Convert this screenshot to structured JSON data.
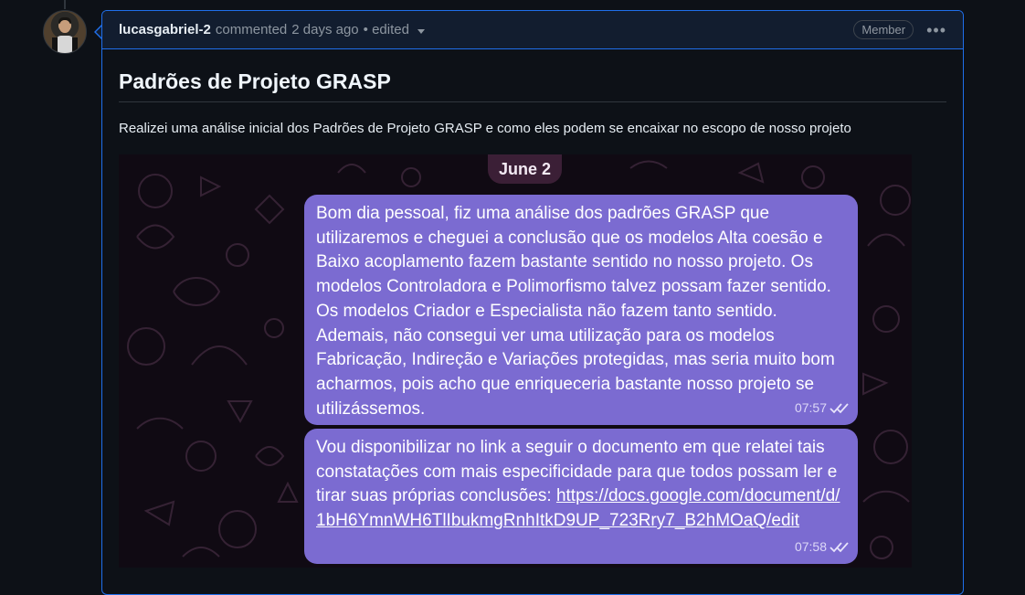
{
  "comment": {
    "author": "lucasgabriel-2",
    "action": "commented",
    "time": "2 days ago",
    "edited": "• edited",
    "badge": "Member",
    "menu_icon": "kebab-horizontal-icon",
    "title": "Padrões de Projeto GRASP",
    "body_text": "Realizei uma análise inicial dos Padrões de Projeto GRASP e como eles podem se encaixar no escopo de nosso projeto"
  },
  "chat_image": {
    "date_label": "June 2",
    "messages": [
      {
        "text": "Bom dia pessoal, fiz uma análise dos padrões GRASP que utilizaremos e cheguei a conclusão que os modelos Alta coesão e Baixo acoplamento fazem bastante sentido no nosso projeto. Os modelos Controladora e Polimorfismo talvez possam fazer sentido. Os modelos Criador e Especialista não fazem tanto sentido. Ademais, não consegui ver uma utilização para os modelos Fabricação, Indireção e Variações protegidas, mas seria muito bom acharmos, pois acho que enriqueceria bastante nosso projeto se utilizássemos.",
        "time": "07:57",
        "status_icon": "double-check-icon"
      },
      {
        "text": "Vou disponibilizar no link a seguir o documento em que relatei tais constatações com mais especificidade para que todos possam ler e tirar suas próprias conclusões:",
        "link": "https://docs.google.com/document/d/1bH6YmnWH6TlIbukmgRnhItkD9UP_723Rry7_B2hMOaQ/edit",
        "time": "07:58",
        "status_icon": "double-check-icon"
      }
    ]
  },
  "colors": {
    "page_bg": "#0d1117",
    "accent_border": "#1f6feb",
    "header_bg": "#121d2f",
    "bubble": "#7b6bd1",
    "chat_bg": "#100a13"
  }
}
